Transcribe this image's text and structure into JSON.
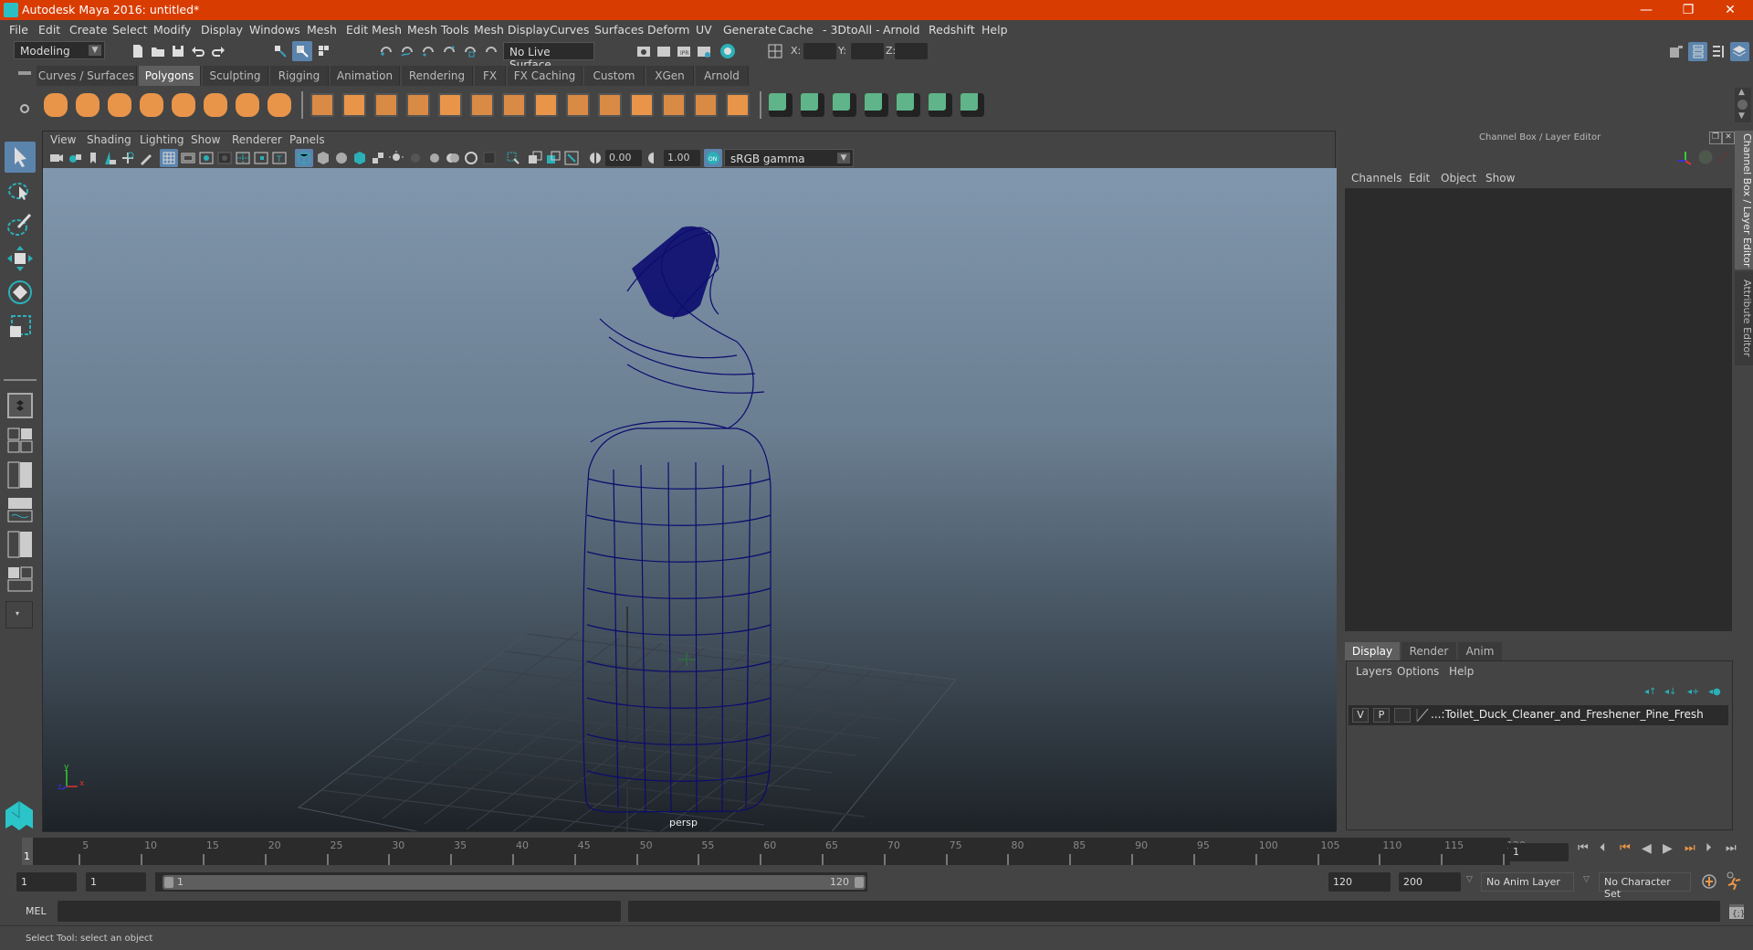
{
  "window": {
    "title": "Autodesk Maya 2016: untitled*",
    "controls": {
      "minimize": "—",
      "restore": "❐",
      "close": "✕"
    }
  },
  "menubar": [
    "File",
    "Edit",
    "Create",
    "Select",
    "Modify",
    "Display",
    "Windows",
    "Mesh",
    "Edit Mesh",
    "Mesh Tools",
    "Mesh Display",
    "Curves",
    "Surfaces",
    "Deform",
    "UV",
    "Generate",
    "Cache",
    "- 3DtoAll -",
    "Arnold",
    "Redshift",
    "Help"
  ],
  "status_line": {
    "menu_set": "Modeling",
    "live_surface": "No Live Surface",
    "x_label": "X:",
    "y_label": "Y:",
    "z_label": "Z:",
    "x_value": "",
    "y_value": "",
    "z_value": ""
  },
  "shelf": {
    "tabs": [
      "Curves / Surfaces",
      "Polygons",
      "Sculpting",
      "Rigging",
      "Animation",
      "Rendering",
      "FX",
      "FX Caching",
      "Custom",
      "XGen",
      "Arnold"
    ],
    "active_tab": "Polygons",
    "icons": [
      "poly-sphere-icon",
      "poly-cube-icon",
      "poly-cylinder-icon",
      "poly-cone-icon",
      "poly-plane-icon",
      "poly-torus-icon",
      "poly-pyramid-icon",
      "poly-pipe-icon",
      "combine-icon",
      "separate-icon",
      "mirror-icon",
      "smooth-icon",
      "extrude-icon",
      "bridge-icon",
      "multi-cut-icon",
      "bevel-icon",
      "merge-icon",
      "target-weld-icon",
      "quad-draw-icon",
      "insert-edge-loop-icon",
      "offset-edge-loop-icon",
      "crease-icon",
      "uv-planar-icon",
      "uv-cylindrical-icon",
      "uv-spherical-icon",
      "uv-automatic-icon",
      "uv-unfold-icon",
      "uv-editor-icon",
      "uv-layout-icon"
    ]
  },
  "viewport": {
    "menu": [
      "View",
      "Shading",
      "Lighting",
      "Show",
      "Renderer",
      "Panels"
    ],
    "exposure": "0.00",
    "gamma": "1.00",
    "color_space": "sRGB gamma",
    "camera_label": "persp",
    "axis": {
      "x": "x",
      "y": "y",
      "z": "z"
    }
  },
  "channel_box": {
    "title": "Channel Box / Layer Editor",
    "menu": [
      "Channels",
      "Edit",
      "Object",
      "Show"
    ]
  },
  "layer_editor": {
    "tabs": [
      "Display",
      "Render",
      "Anim"
    ],
    "active_tab": "Display",
    "menu": [
      "Layers",
      "Options",
      "Help"
    ],
    "layers": [
      {
        "visible": "V",
        "playback": "P",
        "name": "...:Toilet_Duck_Cleaner_and_Freshener_Pine_Fresh"
      }
    ]
  },
  "side_tabs": [
    "Channel Box / Layer Editor",
    "Attribute Editor"
  ],
  "time_slider": {
    "current_frame_marker": "1",
    "ticks": [
      "5",
      "10",
      "15",
      "20",
      "25",
      "30",
      "35",
      "40",
      "45",
      "50",
      "55",
      "60",
      "65",
      "70",
      "75",
      "80",
      "85",
      "90",
      "95",
      "100",
      "105",
      "110",
      "115",
      "120"
    ],
    "current_frame": "1"
  },
  "range_slider": {
    "start_time": "1",
    "playback_start": "1",
    "range_start_label": "1",
    "range_end_label": "120",
    "playback_end": "120",
    "end_time": "200",
    "anim_layer": "No Anim Layer",
    "character_set": "No Character Set"
  },
  "command_line": {
    "label": "MEL",
    "input": "",
    "result": ""
  },
  "help_line": "Select Tool: select an object"
}
